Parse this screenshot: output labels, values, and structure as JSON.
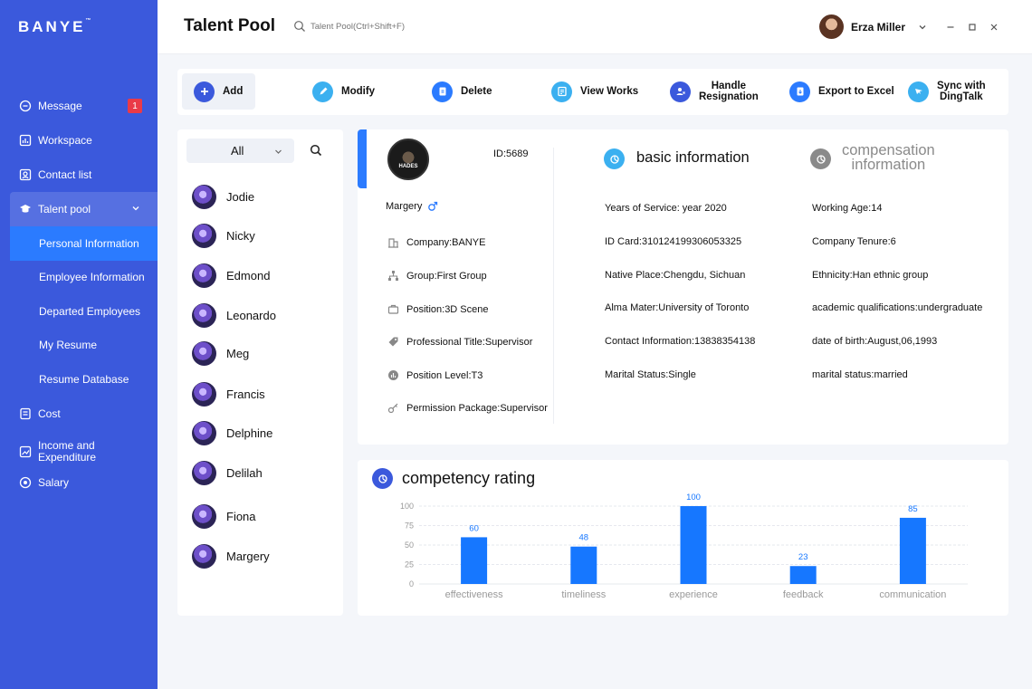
{
  "app": {
    "logo": "BANYE",
    "logo_tm": "™"
  },
  "topbar": {
    "title": "Talent Pool",
    "search_placeholder": "Talent Pool(Ctrl+Shift+F)",
    "user_name": "Erza Miller"
  },
  "sidebar": {
    "items": [
      {
        "label": "Message",
        "badge": "1",
        "icon": "message-icon"
      },
      {
        "label": "Workspace",
        "icon": "workspace-icon"
      },
      {
        "label": "Contact list",
        "icon": "contact-icon"
      },
      {
        "label": "Talent pool",
        "icon": "graduation-cap-icon",
        "expanded": true
      },
      {
        "label": "Cost",
        "icon": "cost-icon"
      },
      {
        "label": "Income and Expenditure",
        "icon": "chart-icon"
      },
      {
        "label": "Salary",
        "icon": "salary-icon"
      }
    ],
    "sub_items": [
      {
        "label": "Personal Information",
        "active": true
      },
      {
        "label": "Employee Information"
      },
      {
        "label": "Departed Employees"
      },
      {
        "label": "My Resume"
      },
      {
        "label": "Resume Database"
      }
    ]
  },
  "toolbar": {
    "add": "Add",
    "modify": "Modify",
    "delete": "Delete",
    "view_works": "View Works",
    "handle_resignation_1": "Handle",
    "handle_resignation_2": "Resignation",
    "export": "Export to Excel",
    "sync_1": "Sync with",
    "sync_2": "DingTalk"
  },
  "list": {
    "filter": "All",
    "employees": [
      "Jodie",
      "Nicky",
      "Edmond",
      "Leonardo",
      "Meg",
      "Francis",
      "Delphine",
      "Delilah",
      "Fiona",
      "Margery"
    ]
  },
  "profile": {
    "avatar_text": "HADES",
    "id": "ID:5689",
    "name": "Margery",
    "fields": [
      {
        "label": "Company:BANYE",
        "icon": "building-icon"
      },
      {
        "label": "Group:First Group",
        "icon": "org-chart-icon"
      },
      {
        "label": "Position:3D Scene",
        "icon": "briefcase-icon"
      },
      {
        "label": "Professional Title:Supervisor",
        "icon": "tag-icon"
      },
      {
        "label": "Position Level:T3",
        "icon": "level-icon"
      },
      {
        "label": "Permission Package:Supervisor",
        "icon": "key-icon"
      }
    ]
  },
  "basic": {
    "title": "basic information",
    "left": [
      "Years of Service: year 2020",
      "ID Card:310124199306053325",
      "Native Place:Chengdu, Sichuan",
      "Alma Mater:University of Toronto",
      "Contact Information:13838354138",
      "Marital Status:Single"
    ],
    "right": [
      "Working Age:14",
      "Company Tenure:6",
      "Ethnicity:Han ethnic group",
      "academic qualifications:undergraduate",
      "date of birth:August,06,1993",
      "marital status:married"
    ]
  },
  "compensation": {
    "title_1": "compensation",
    "title_2": "information"
  },
  "competency": {
    "title": "competency rating"
  },
  "colors": {
    "sidebar": "#3b59dc",
    "accent": "#2b7bff",
    "bar": "#1677ff",
    "badge": "#ea3a48"
  },
  "chart_data": {
    "type": "bar",
    "title": "competency rating",
    "categories": [
      "effectiveness",
      "timeliness",
      "experience",
      "feedback",
      "communication"
    ],
    "values": [
      60,
      48,
      100,
      23,
      85
    ],
    "ylim": [
      0,
      100
    ],
    "yticks": [
      0,
      25,
      50,
      75,
      100
    ],
    "grid": true
  }
}
